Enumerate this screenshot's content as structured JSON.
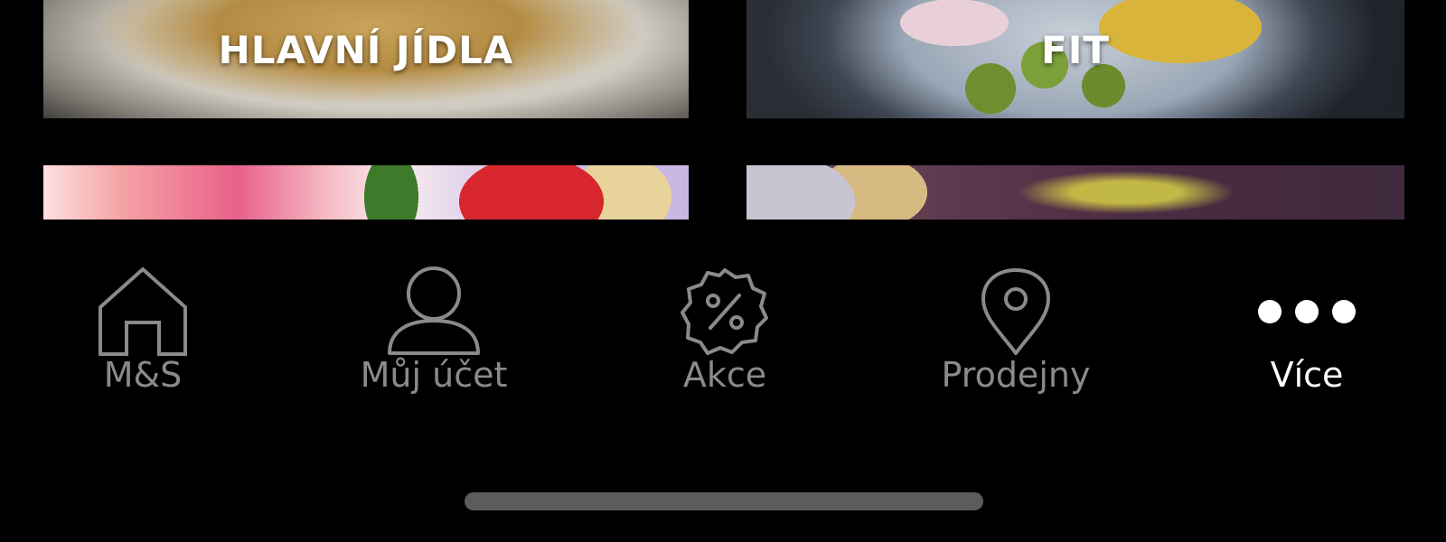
{
  "categories": [
    {
      "id": "hlavni-jidla",
      "title": "HLAVNÍ JÍDLA"
    },
    {
      "id": "fit",
      "title": "FIT"
    },
    {
      "id": "dezerty",
      "title": ""
    },
    {
      "id": "snacky",
      "title": ""
    }
  ],
  "tabbar": {
    "tabs": [
      {
        "id": "ms",
        "label": "M&S",
        "icon": "home-icon",
        "active": false
      },
      {
        "id": "ucet",
        "label": "Můj účet",
        "icon": "person-icon",
        "active": false
      },
      {
        "id": "akce",
        "label": "Akce",
        "icon": "discount-badge-icon",
        "active": false
      },
      {
        "id": "prodejny",
        "label": "Prodejny",
        "icon": "location-pin-icon",
        "active": false
      },
      {
        "id": "vice",
        "label": "Více",
        "icon": "more-dots-icon",
        "active": true
      }
    ]
  },
  "colors": {
    "background": "#000000",
    "inactive": "#8a8a8a",
    "active": "#ffffff",
    "home_indicator": "#5c5c5c"
  }
}
